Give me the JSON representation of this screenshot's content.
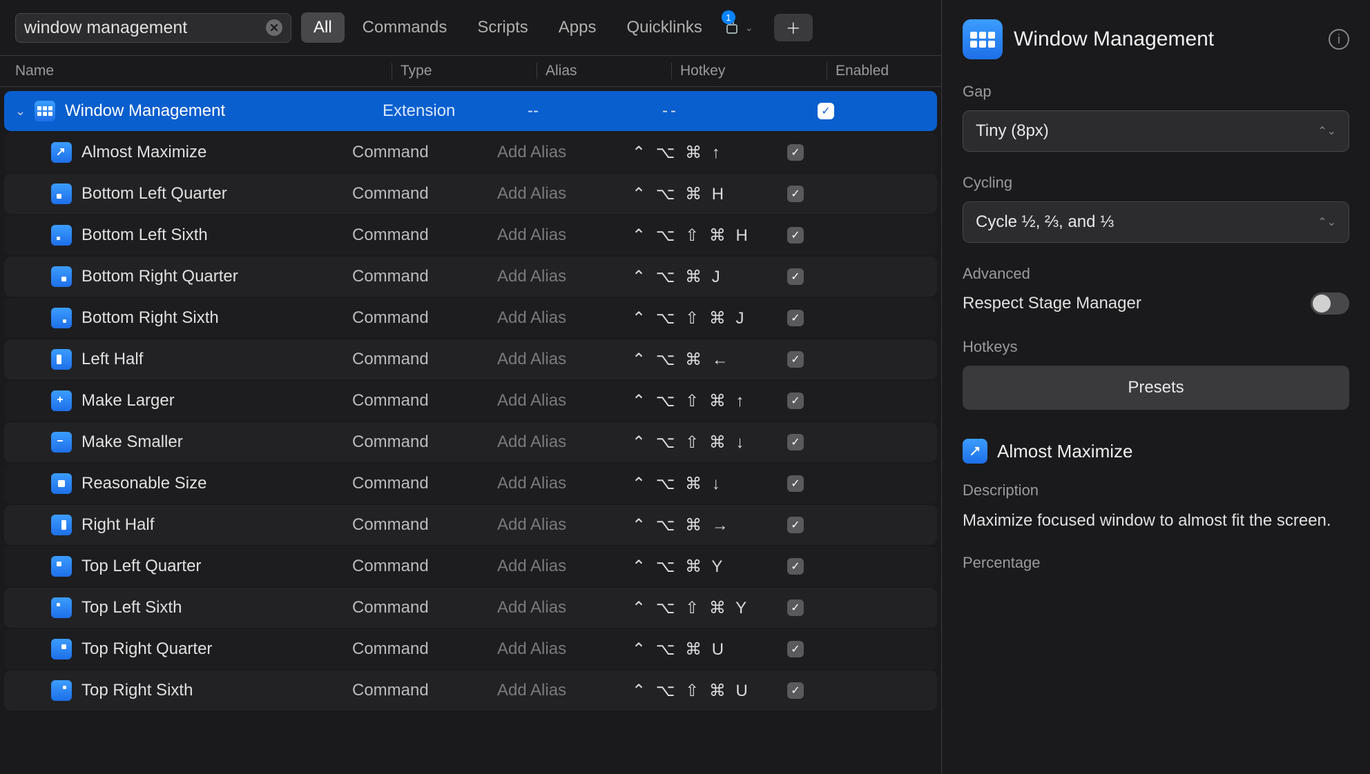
{
  "toolbar": {
    "search_value": "window management",
    "tabs": [
      "All",
      "Commands",
      "Scripts",
      "Apps",
      "Quicklinks"
    ],
    "active_tab": 0,
    "store_badge": "1"
  },
  "columns": {
    "name": "Name",
    "type": "Type",
    "alias": "Alias",
    "hotkey": "Hotkey",
    "enabled": "Enabled"
  },
  "parent_row": {
    "name": "Window Management",
    "type": "Extension",
    "alias": "--",
    "hotkey": "--",
    "enabled": true
  },
  "rows": [
    {
      "icon": "maximize",
      "name": "Almost Maximize",
      "type": "Command",
      "alias": "Add Alias",
      "hotkey": "⌃ ⌥ ⌘ ↑",
      "enabled": true
    },
    {
      "icon": "bl-quarter",
      "name": "Bottom Left Quarter",
      "type": "Command",
      "alias": "Add Alias",
      "hotkey": "⌃ ⌥ ⌘ H",
      "enabled": true
    },
    {
      "icon": "bl-sixth",
      "name": "Bottom Left Sixth",
      "type": "Command",
      "alias": "Add Alias",
      "hotkey": "⌃ ⌥ ⇧ ⌘ H",
      "enabled": true
    },
    {
      "icon": "br-quarter",
      "name": "Bottom Right Quarter",
      "type": "Command",
      "alias": "Add Alias",
      "hotkey": "⌃ ⌥ ⌘ J",
      "enabled": true
    },
    {
      "icon": "br-sixth",
      "name": "Bottom Right Sixth",
      "type": "Command",
      "alias": "Add Alias",
      "hotkey": "⌃ ⌥ ⇧ ⌘ J",
      "enabled": true
    },
    {
      "icon": "left-half",
      "name": "Left Half",
      "type": "Command",
      "alias": "Add Alias",
      "hotkey": "⌃ ⌥ ⌘ ←",
      "enabled": true
    },
    {
      "icon": "larger",
      "name": "Make Larger",
      "type": "Command",
      "alias": "Add Alias",
      "hotkey": "⌃ ⌥ ⇧ ⌘ ↑",
      "enabled": true
    },
    {
      "icon": "smaller",
      "name": "Make Smaller",
      "type": "Command",
      "alias": "Add Alias",
      "hotkey": "⌃ ⌥ ⇧ ⌘ ↓",
      "enabled": true
    },
    {
      "icon": "reasonable",
      "name": "Reasonable Size",
      "type": "Command",
      "alias": "Add Alias",
      "hotkey": "⌃ ⌥ ⌘ ↓",
      "enabled": true
    },
    {
      "icon": "right-half",
      "name": "Right Half",
      "type": "Command",
      "alias": "Add Alias",
      "hotkey": "⌃ ⌥ ⌘ →",
      "enabled": true
    },
    {
      "icon": "tl-quarter",
      "name": "Top Left Quarter",
      "type": "Command",
      "alias": "Add Alias",
      "hotkey": "⌃ ⌥ ⌘ Y",
      "enabled": true
    },
    {
      "icon": "tl-sixth",
      "name": "Top Left Sixth",
      "type": "Command",
      "alias": "Add Alias",
      "hotkey": "⌃ ⌥ ⇧ ⌘ Y",
      "enabled": true
    },
    {
      "icon": "tr-quarter",
      "name": "Top Right Quarter",
      "type": "Command",
      "alias": "Add Alias",
      "hotkey": "⌃ ⌥ ⌘ U",
      "enabled": true
    },
    {
      "icon": "tr-sixth",
      "name": "Top Right Sixth",
      "type": "Command",
      "alias": "Add Alias",
      "hotkey": "⌃ ⌥ ⇧ ⌘ U",
      "enabled": true
    }
  ],
  "panel": {
    "title": "Window Management",
    "gap_label": "Gap",
    "gap_value": "Tiny (8px)",
    "cycling_label": "Cycling",
    "cycling_value": "Cycle ½, ⅔, and ⅓",
    "advanced_label": "Advanced",
    "stage_label": "Respect Stage Manager",
    "stage_on": false,
    "hotkeys_label": "Hotkeys",
    "presets_label": "Presets",
    "selected_cmd": "Almost Maximize",
    "desc_label": "Description",
    "desc_text": "Maximize focused window to almost fit the screen.",
    "percentage_label": "Percentage"
  }
}
